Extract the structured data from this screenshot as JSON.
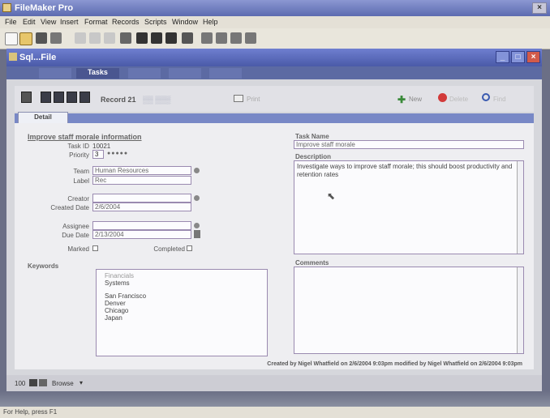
{
  "app": {
    "title": "FileMaker Pro"
  },
  "menubar": {
    "items": [
      "File",
      "Edit",
      "View",
      "Insert",
      "Format",
      "Records",
      "Scripts",
      "Window",
      "Help"
    ]
  },
  "window": {
    "title": "Sql...File"
  },
  "tabs": [
    "Tasks"
  ],
  "record_bar": {
    "label": "Record 21",
    "new_label": "New",
    "delete_label": "Delete",
    "find_label": "Find",
    "print_label": "Print"
  },
  "detail_tab": "Detail",
  "form": {
    "heading": "Improve staff morale information",
    "task_id_label": "Task ID",
    "task_id_value": "10021",
    "priority_label": "Priority",
    "priority_value": "3",
    "priority_stars": "●●●●●",
    "team_label": "Team",
    "team_value": "Human Resources",
    "label_label": "Label",
    "label_value": "Rec",
    "creator_label": "Creator",
    "creator_value": "",
    "created_date_label": "Created Date",
    "created_date_value": "2/6/2004",
    "assignee_label": "Assignee",
    "assignee_value": "",
    "due_date_label": "Due Date",
    "due_date_value": "2/13/2004",
    "marked_label": "Marked",
    "completed_label": "Completed",
    "task_name_label": "Task Name",
    "task_name_value": "Improve staff morale",
    "description_label": "Description",
    "description_value": "Investigate ways to improve staff morale; this should boost productivity and retention rates",
    "keywords_label": "Keywords",
    "keywords": [
      "Financials",
      "Systems",
      "",
      "San Francisco",
      "Denver",
      "Chicago",
      "Japan"
    ],
    "comments_label": "Comments",
    "footer_text": "Created by Nigel Whatfield on 2/6/2004 9:03pm modified by Nigel Whatfield on 2/6/2004 9:03pm"
  },
  "status": {
    "zoom": "100",
    "mode": "Browse"
  },
  "helpbar": {
    "text": "For Help, press F1"
  },
  "colors": {
    "title_blue": "#5c6bb0",
    "form_bg": "#eeeef1",
    "field_border": "#9a8ab0"
  }
}
